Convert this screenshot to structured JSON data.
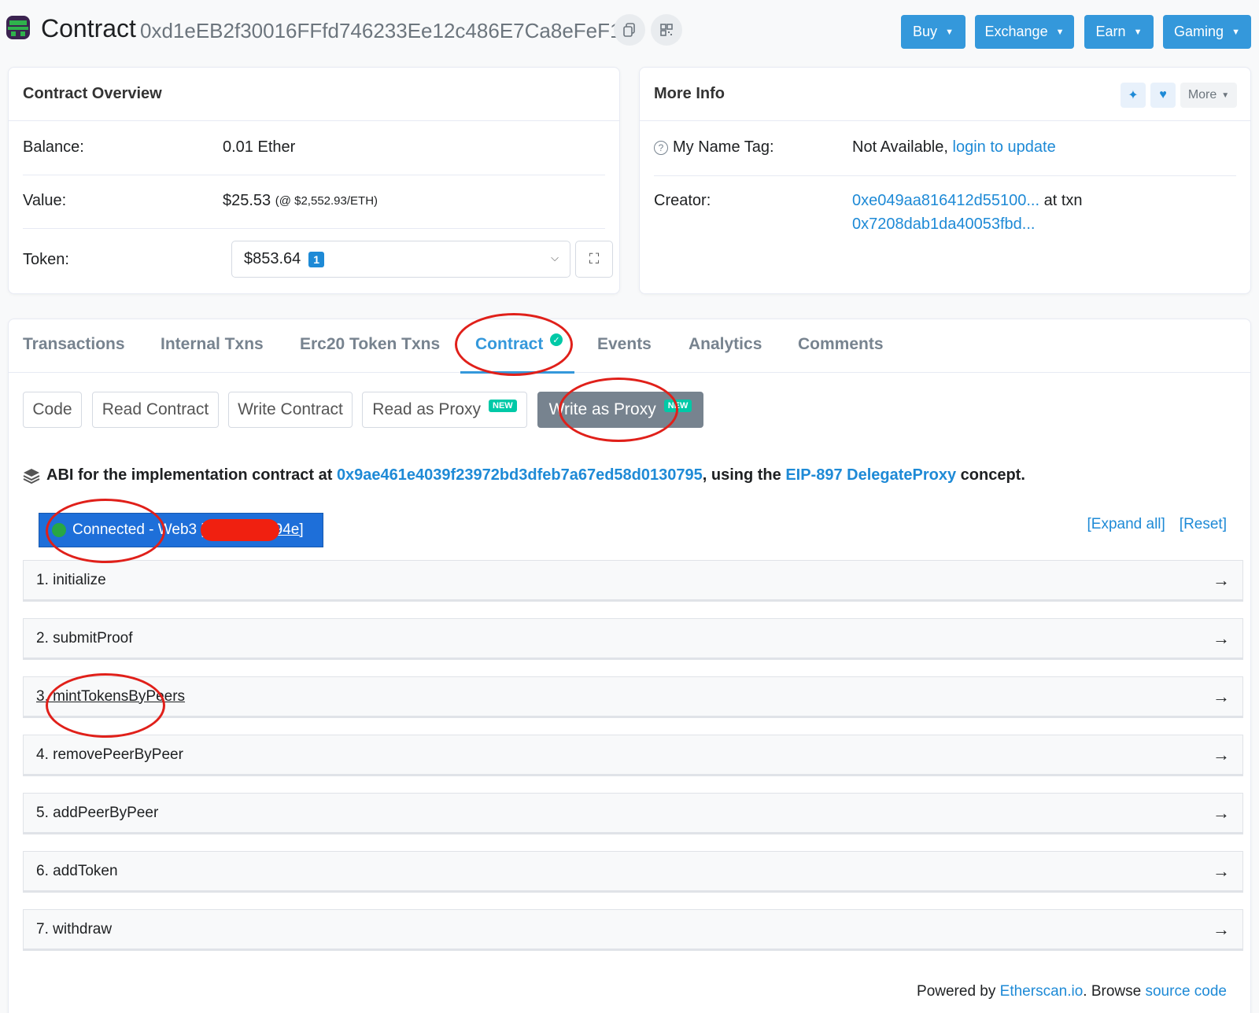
{
  "header": {
    "title": "Contract",
    "address": "0xd1eEB2f30016FFfd746233Ee12c486E7Ca8eFeF1",
    "nav": [
      {
        "label": "Buy"
      },
      {
        "label": "Exchange"
      },
      {
        "label": "Earn"
      },
      {
        "label": "Gaming"
      }
    ]
  },
  "overview": {
    "title": "Contract Overview",
    "balance_label": "Balance:",
    "balance_value": "0.01 Ether",
    "value_label": "Value:",
    "value_value": "$25.53",
    "value_rate": "(@ $2,552.93/ETH)",
    "token_label": "Token:",
    "token_value": "$853.64",
    "token_count": "1"
  },
  "more_info": {
    "title": "More Info",
    "more_label": "More",
    "name_tag_label": "My Name Tag:",
    "name_tag_value": "Not Available,",
    "name_tag_link": "login to update",
    "creator_label": "Creator:",
    "creator_address": "0xe049aa816412d55100...",
    "creator_at_txn": "at txn",
    "creator_txn": "0x7208dab1da40053fbd..."
  },
  "tabs": [
    {
      "label": "Transactions"
    },
    {
      "label": "Internal Txns"
    },
    {
      "label": "Erc20 Token Txns"
    },
    {
      "label": "Contract"
    },
    {
      "label": "Events"
    },
    {
      "label": "Analytics"
    },
    {
      "label": "Comments"
    }
  ],
  "subtabs": [
    {
      "label": "Code"
    },
    {
      "label": "Read Contract"
    },
    {
      "label": "Write Contract"
    },
    {
      "label": "Read as Proxy",
      "badge": "NEW"
    },
    {
      "label": "Write as Proxy",
      "badge": "NEW"
    }
  ],
  "abi": {
    "prefix": "ABI for the implementation contract at",
    "impl_address": "0x9ae461e4039f23972bd3dfeb7a67ed58d0130795",
    "middle": ", using the",
    "eip_link": "EIP-897 DelegateProxy",
    "suffix": "concept."
  },
  "connection": {
    "text": "Connected - Web3 [",
    "suffix": "94e]"
  },
  "actions": {
    "expand_all": "[Expand all]",
    "reset": "[Reset]"
  },
  "functions": [
    "1. initialize",
    "2. submitProof",
    "3. mintTokensByPeers",
    "4. removePeerByPeer",
    "5. addPeerByPeer",
    "6. addToken",
    "7. withdraw"
  ],
  "footer": {
    "powered_prefix": "Powered by",
    "etherscan": "Etherscan.io",
    "browse": ". Browse",
    "source_code": "source code"
  },
  "colors": {
    "accent": "#3498db",
    "link": "#1e8ad6",
    "annotation": "#e0201a",
    "connected": "#1e6fd9"
  }
}
